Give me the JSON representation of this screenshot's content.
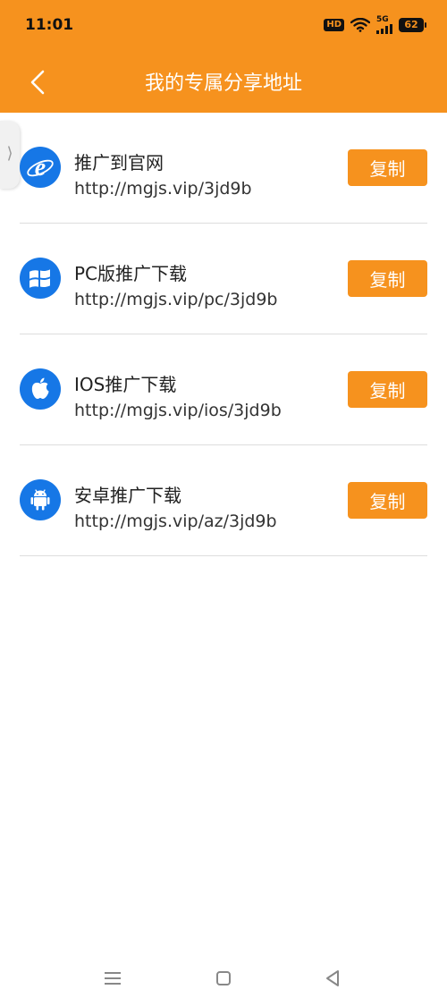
{
  "status_bar": {
    "time": "11:01",
    "hd": "HD",
    "network": "5G",
    "battery": "62"
  },
  "header": {
    "title": "我的专属分享地址",
    "back_icon": "chevron-left-icon"
  },
  "items": [
    {
      "title": "推广到官网",
      "url": "http://mgjs.vip/3jd9b",
      "icon": "internet-explorer-icon",
      "copy_label": "复制"
    },
    {
      "title": "PC版推广下载",
      "url": "http://mgjs.vip/pc/3jd9b",
      "icon": "windows-icon",
      "copy_label": "复制"
    },
    {
      "title": "IOS推广下载",
      "url": "http://mgjs.vip/ios/3jd9b",
      "icon": "apple-icon",
      "copy_label": "复制"
    },
    {
      "title": "安卓推广下载",
      "url": "http://mgjs.vip/az/3jd9b",
      "icon": "android-icon",
      "copy_label": "复制"
    }
  ],
  "side_tab": {
    "glyph": "⟩"
  },
  "colors": {
    "accent": "#F6921E",
    "icon_bg": "#1677E6",
    "divider": "#DDDDDD"
  },
  "nav_bar": {
    "icons": [
      "menu-icon",
      "home-square-icon",
      "back-triangle-icon"
    ]
  }
}
